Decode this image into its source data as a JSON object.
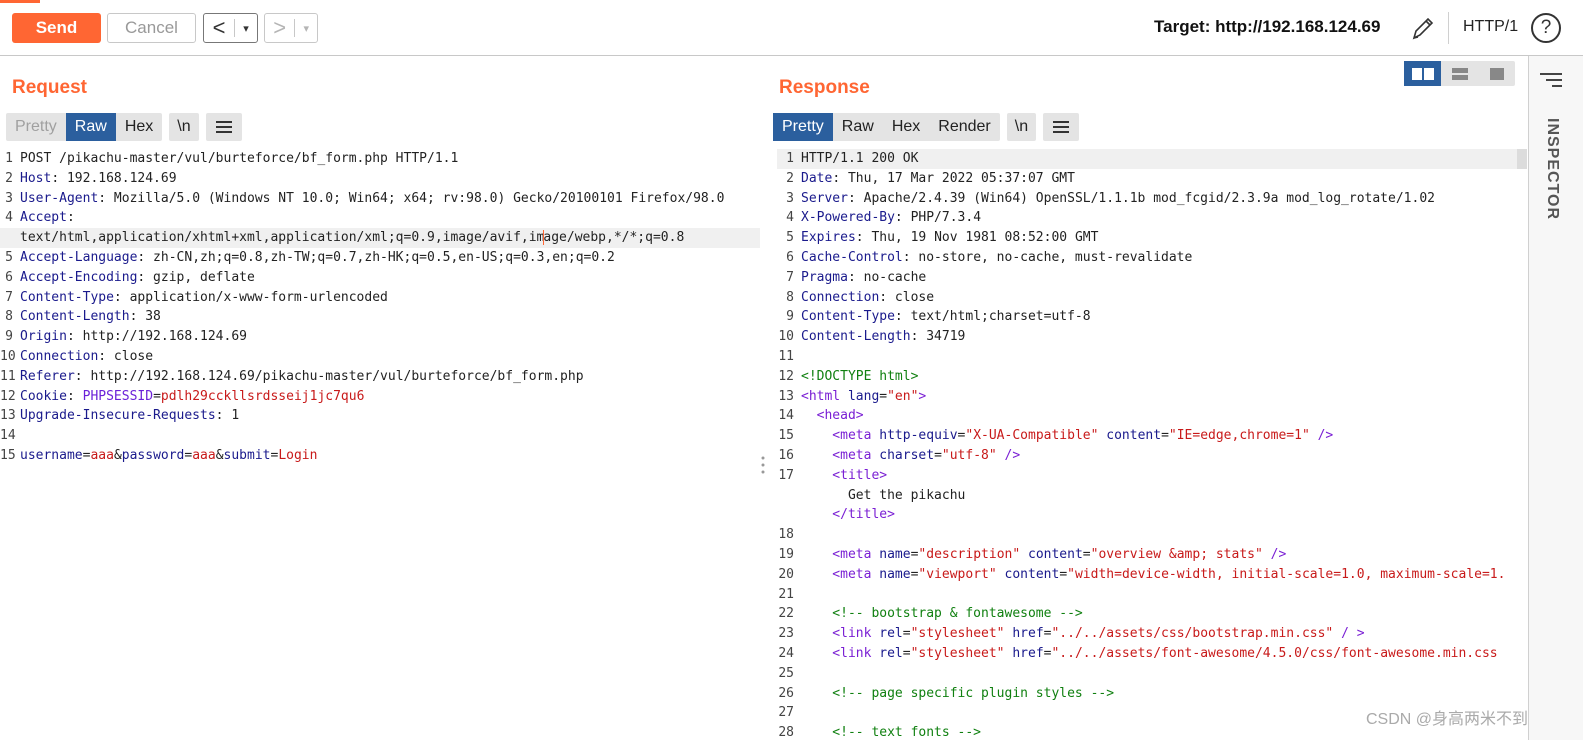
{
  "toolbar": {
    "send_label": "Send",
    "cancel_label": "Cancel",
    "back_label": "<",
    "forward_label": ">",
    "dropdown_label": "▾",
    "target_text": "Target: http://192.168.124.69",
    "protocol_label": "HTTP/1",
    "help_label": "?"
  },
  "request": {
    "title": "Request",
    "tabs": [
      "Pretty",
      "Raw",
      "Hex"
    ],
    "active_tab": "Raw",
    "newline_button": "\\n",
    "line_numbers": [
      "1",
      "2",
      "3",
      "4",
      "",
      "5",
      "6",
      "7",
      "8",
      "9",
      "10",
      "11",
      "12",
      "13",
      "14",
      "15"
    ],
    "lines": {
      "l1": "POST /pikachu-master/vul/burteforce/bf_form.php HTTP/1.1",
      "l2_key": "Host",
      "l2_val": ": 192.168.124.69",
      "l3_key": "User-Agent",
      "l3_val": ": Mozilla/5.0 (Windows NT 10.0; Win64; x64; rv:98.0) Gecko/20100101 Firefox/98.0",
      "l4_key": "Accept",
      "l4_val": ":",
      "l4b_a": "text/html,application/xhtml+xml,application/xml;q=0.9,image/avif,im",
      "l4b_b": "age/webp,*/*;q=0.8",
      "l5_key": "Accept-Language",
      "l5_val": ": zh-CN,zh;q=0.8,zh-TW;q=0.7,zh-HK;q=0.5,en-US;q=0.3,en;q=0.2",
      "l6_key": "Accept-Encoding",
      "l6_val": ": gzip, deflate",
      "l7_key": "Content-Type",
      "l7_val": ": application/x-www-form-urlencoded",
      "l8_key": "Content-Length",
      "l8_val": ": 38",
      "l9_key": "Origin",
      "l9_val": ": http://192.168.124.69",
      "l10_key": "Connection",
      "l10_val": ": close",
      "l11_key": "Referer",
      "l11_val": ": http://192.168.124.69/pikachu-master/vul/burteforce/bf_form.php",
      "l12_key": "Cookie",
      "l12_sep": ": ",
      "l12_cname": "PHPSESSID",
      "l12_eq": "=",
      "l12_cval": "pdlh29cckllsrdsseij1jc7qu6",
      "l13_key": "Upgrade-Insecure-Requests",
      "l13_val": ": 1",
      "l15_p1": "username",
      "l15_v1": "aaa",
      "l15_p2": "password",
      "l15_v2": "aaa",
      "l15_p3": "submit",
      "l15_v3": "Login",
      "eq": "=",
      "amp": "&"
    }
  },
  "response": {
    "title": "Response",
    "tabs": [
      "Pretty",
      "Raw",
      "Hex",
      "Render"
    ],
    "active_tab": "Pretty",
    "newline_button": "\\n",
    "line_numbers": [
      "1",
      "2",
      "3",
      "4",
      "5",
      "6",
      "7",
      "8",
      "9",
      "10",
      "11",
      "12",
      "13",
      "14",
      "15",
      "16",
      "17",
      "",
      "",
      "18",
      "19",
      "20",
      "21",
      "22",
      "23",
      "24",
      "25",
      "26",
      "27",
      "28"
    ],
    "lines": {
      "r1": "HTTP/1.1 200 OK",
      "r2_key": "Date",
      "r2_val": ": Thu, 17 Mar 2022 05:37:07 GMT",
      "r3_key": "Server",
      "r3_val": ": Apache/2.4.39 (Win64) OpenSSL/1.1.1b mod_fcgid/2.3.9a mod_log_rotate/1.02",
      "r4_key": "X-Powered-By",
      "r4_val": ": PHP/7.3.4",
      "r5_key": "Expires",
      "r5_val": ": Thu, 19 Nov 1981 08:52:00 GMT",
      "r6_key": "Cache-Control",
      "r6_val": ": no-store, no-cache, must-revalidate",
      "r7_key": "Pragma",
      "r7_val": ": no-cache",
      "r8_key": "Connection",
      "r8_val": ": close",
      "r9_key": "Content-Type",
      "r9_val": ": text/html;charset=utf-8",
      "r10_key": "Content-Length",
      "r10_val": ": 34719",
      "r12": "<!DOCTYPE html>",
      "r13_open": "<html",
      "r13_attr": " lang",
      "r13_eq": "=",
      "r13_val": "\"en\"",
      "r13_close": ">",
      "r14": "  <head>",
      "r15_open": "    <meta",
      "r15_a1": " http-equiv",
      "r15_v1": "\"X-UA-Compatible\"",
      "r15_a2": " content",
      "r15_v2": "\"IE=edge,chrome=1\"",
      "r15_close": " />",
      "r16_open": "    <meta",
      "r16_a1": " charset",
      "r16_v1": "\"utf-8\"",
      "r16_close": " />",
      "r17": "    <title>",
      "r17b": "      Get the pikachu",
      "r17c": "    </title>",
      "r19_open": "    <meta",
      "r19_a1": " name",
      "r19_v1": "\"description\"",
      "r19_a2": " content",
      "r19_v2": "\"overview &amp; stats\"",
      "r19_close": " />",
      "r20_open": "    <meta",
      "r20_a1": " name",
      "r20_v1": "\"viewport\"",
      "r20_a2": " content",
      "r20_v2": "\"width=device-width, initial-scale=1.0, maximum-scale=1.",
      "r22": "    <!-- bootstrap & fontawesome -->",
      "r23_open": "    <link",
      "r23_a1": " rel",
      "r23_v1": "\"stylesheet\"",
      "r23_a2": " href",
      "r23_v2": "\"../../assets/css/bootstrap.min.css\"",
      "r23_close": " / >",
      "r24_open": "    <link",
      "r24_a1": " rel",
      "r24_v1": "\"stylesheet\"",
      "r24_a2": " href",
      "r24_v2": "\"../../assets/font-awesome/4.5.0/css/font-awesome.min.css",
      "r26": "    <!-- page specific plugin styles -->",
      "r28": "    <!-- text fonts -->",
      "eq": "="
    }
  },
  "inspector": {
    "label": "INSPECTOR"
  },
  "watermark": "CSDN @身高两米不到",
  "colors": {
    "accent": "#ff6633",
    "active_tab": "#2b5f9e",
    "header_key": "#1a1a8c",
    "string": "#c81a1a",
    "tag": "#7a1fd4",
    "comment": "#108010"
  }
}
